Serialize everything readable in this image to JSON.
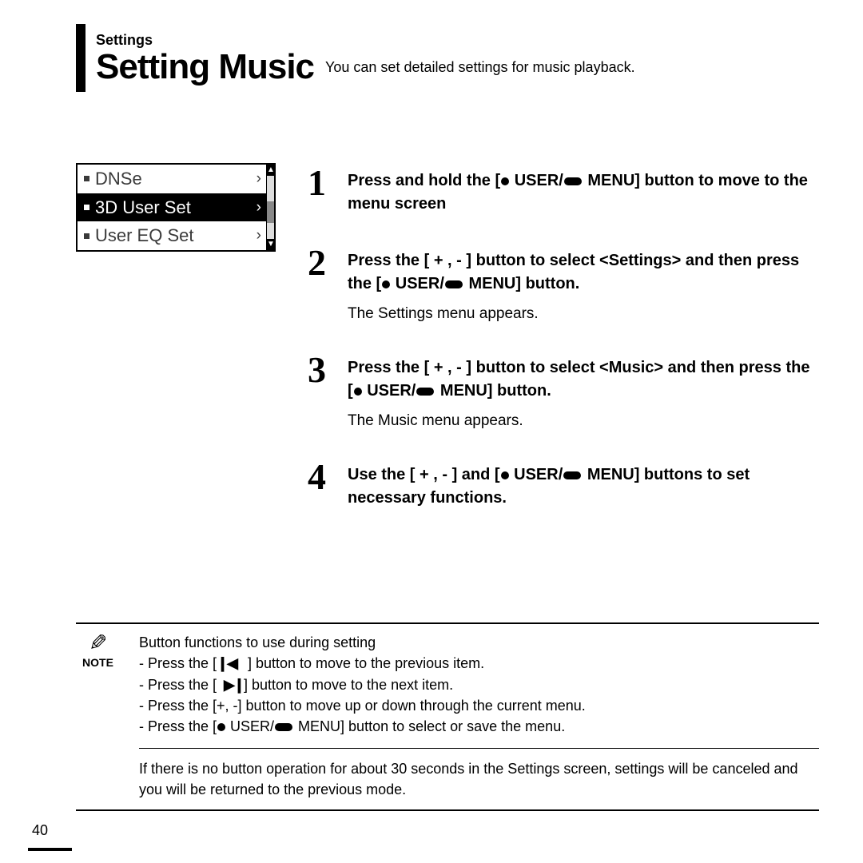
{
  "header": {
    "section": "Settings",
    "title": "Setting Music",
    "subtitle": "You can set detailed settings for music playback."
  },
  "lcd": {
    "items": [
      {
        "label": "DNSe",
        "selected": false
      },
      {
        "label": "3D User Set",
        "selected": true
      },
      {
        "label": "User EQ Set",
        "selected": false
      }
    ]
  },
  "steps": [
    {
      "num": "1",
      "title_a": "Press and hold the [",
      "title_b": " USER/",
      "title_c": " MENU] button to move to the menu screen",
      "sub": ""
    },
    {
      "num": "2",
      "title_a": "Press the [ + , - ] button to select <Settings> and then press the [",
      "title_b": " USER/",
      "title_c": " MENU] button.",
      "sub": "The Settings menu appears."
    },
    {
      "num": "3",
      "title_a": "Press the [ + , - ] button to select <Music> and then press the [",
      "title_b": " USER/",
      "title_c": " MENU] button.",
      "sub": "The Music menu appears."
    },
    {
      "num": "4",
      "title_a": "Use the [ + , - ] and [",
      "title_b": " USER/",
      "title_c": " MENU] buttons to set necessary functions.",
      "sub": ""
    }
  ],
  "note": {
    "label": "NOTE",
    "lines": {
      "l0": "Button functions to use during setting",
      "l1a": "- Press the [",
      "l1b": "] button to move to the previous item.",
      "l2a": "- Press the [",
      "l2b": "] button to move to the next item.",
      "l3": "- Press the [+, -] button to move up or down through the current menu.",
      "l4a": "- Press the [",
      "l4b": " USER/",
      "l4c": " MENU] button to select or save the menu.",
      "para": "If there is no button operation for about 30 seconds in the Settings screen, settings will be canceled and you will be returned to the previous mode."
    }
  },
  "page_number": "40"
}
